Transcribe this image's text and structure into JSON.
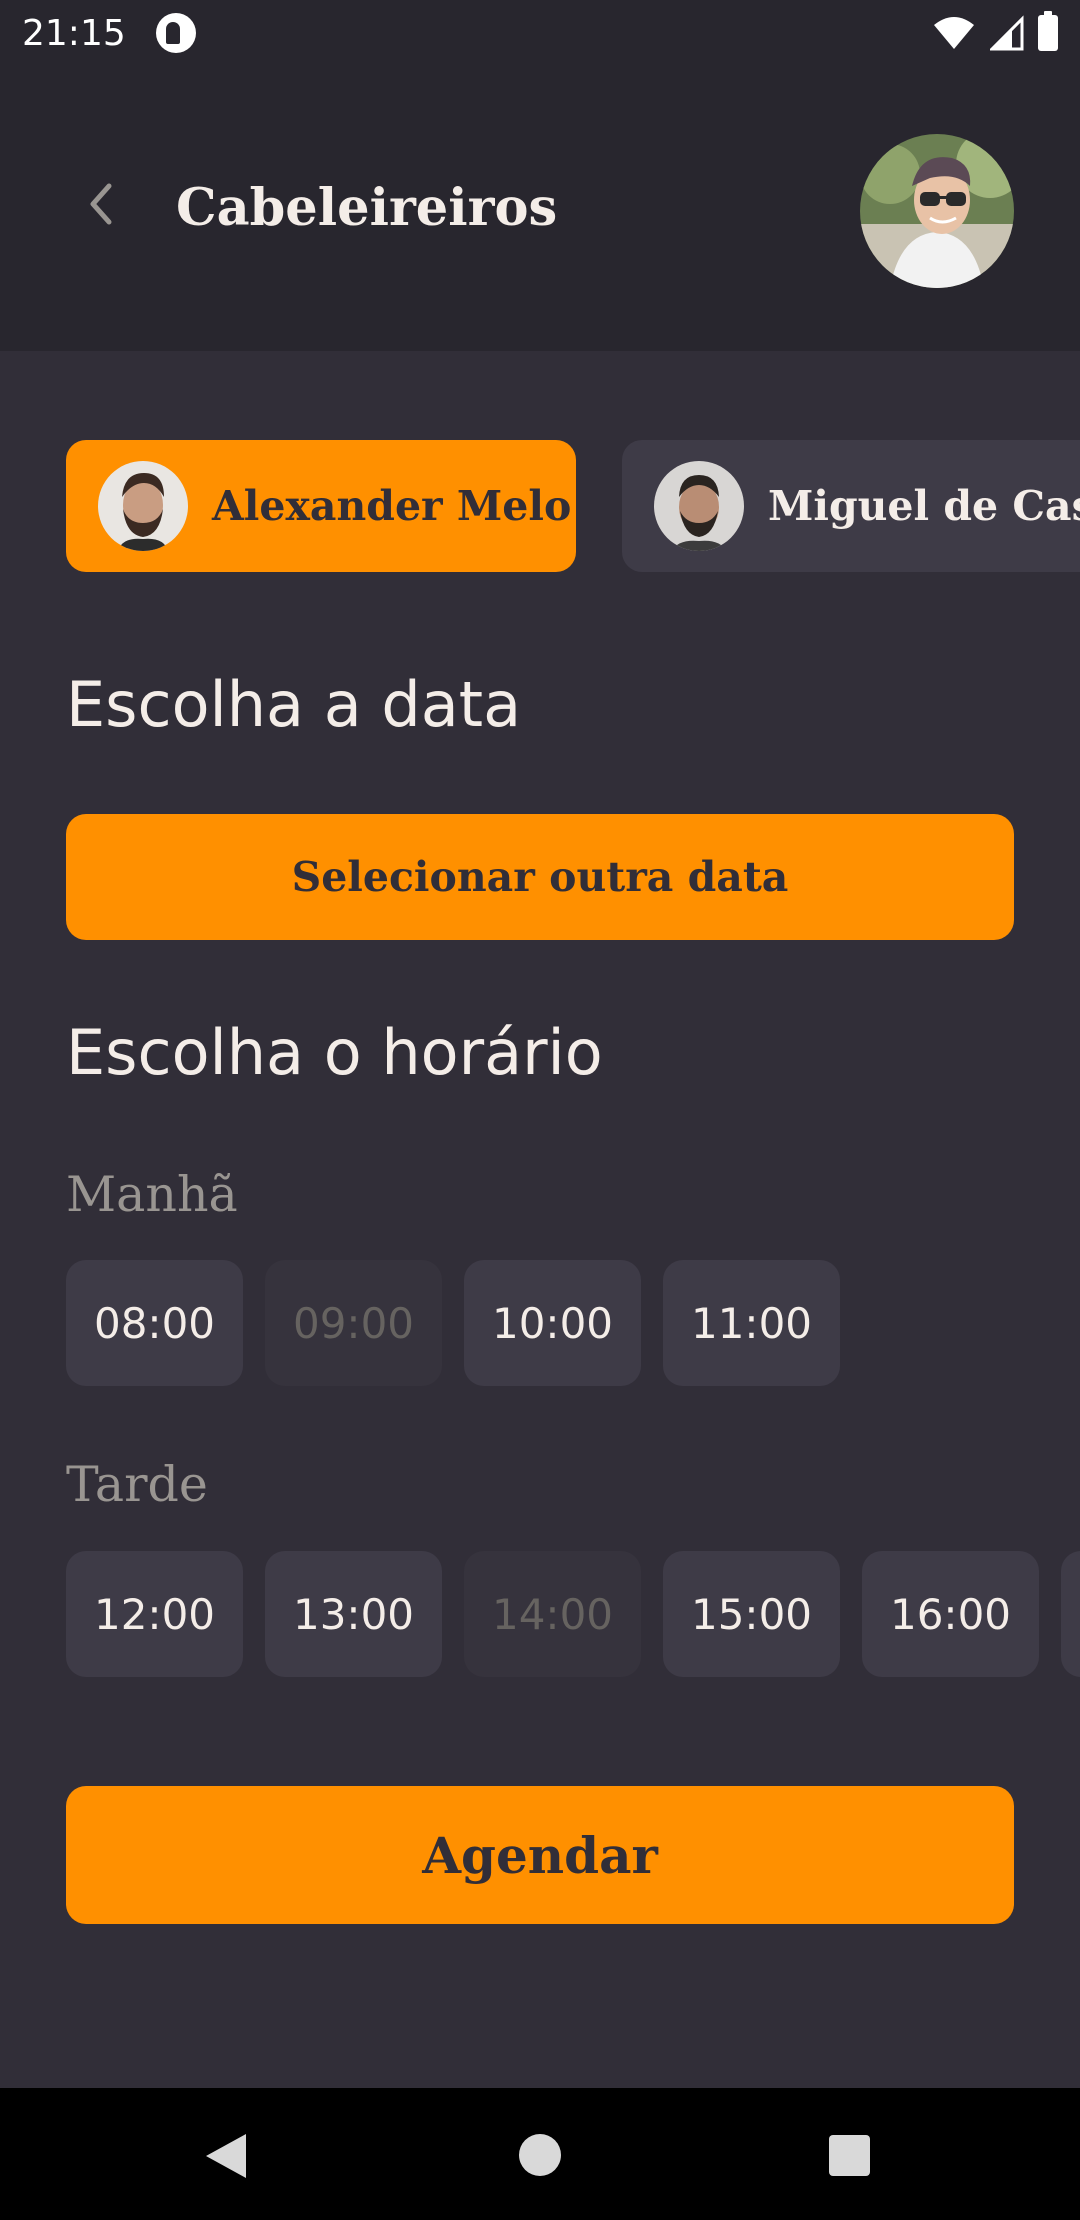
{
  "status_bar": {
    "time": "21:15"
  },
  "header": {
    "title": "Cabeleireiros"
  },
  "providers": [
    {
      "name": "Alexander Melo",
      "selected": true
    },
    {
      "name": "Miguel de Castr",
      "selected": false
    }
  ],
  "date_section": {
    "title": "Escolha a data",
    "select_date_label": "Selecionar outra data"
  },
  "time_section": {
    "title": "Escolha o horário",
    "morning": {
      "label": "Manhã",
      "slots": [
        {
          "time": "08:00",
          "available": true
        },
        {
          "time": "09:00",
          "available": false
        },
        {
          "time": "10:00",
          "available": true
        },
        {
          "time": "11:00",
          "available": true
        }
      ]
    },
    "afternoon": {
      "label": "Tarde",
      "slots": [
        {
          "time": "12:00",
          "available": true
        },
        {
          "time": "13:00",
          "available": true
        },
        {
          "time": "14:00",
          "available": false
        },
        {
          "time": "15:00",
          "available": true
        },
        {
          "time": "16:00",
          "available": true
        },
        {
          "time": "",
          "available": true
        }
      ]
    }
  },
  "schedule_button": {
    "label": "Agendar"
  },
  "colors": {
    "background": "#312e38",
    "header": "#28262e",
    "accent": "#ff9000",
    "chip": "#3e3b47",
    "muted_text": "#999591",
    "text": "#f4ede8"
  }
}
